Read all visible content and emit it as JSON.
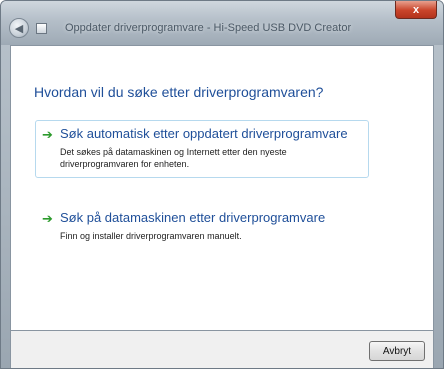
{
  "window": {
    "title": "Oppdater driverprogramvare - Hi-Speed USB DVD Creator",
    "close_glyph": "x"
  },
  "main": {
    "heading": "Hvordan vil du søke etter driverprogramvaren?",
    "options": [
      {
        "title": "Søk automatisk etter oppdatert driverprogramvare",
        "description": "Det søkes på datamaskinen og Internett etter den nyeste driverprogramvaren for enheten.",
        "icon": "green-arrow-icon"
      },
      {
        "title": "Søk på datamaskinen etter driverprogramvare",
        "description": "Finn og installer driverprogramvaren manuelt.",
        "icon": "green-arrow-icon"
      }
    ]
  },
  "footer": {
    "cancel_label": "Avbryt"
  },
  "colors": {
    "heading": "#1f4f99",
    "arrow": "#2c9a2c",
    "highlight_border": "#b6d9ee"
  }
}
